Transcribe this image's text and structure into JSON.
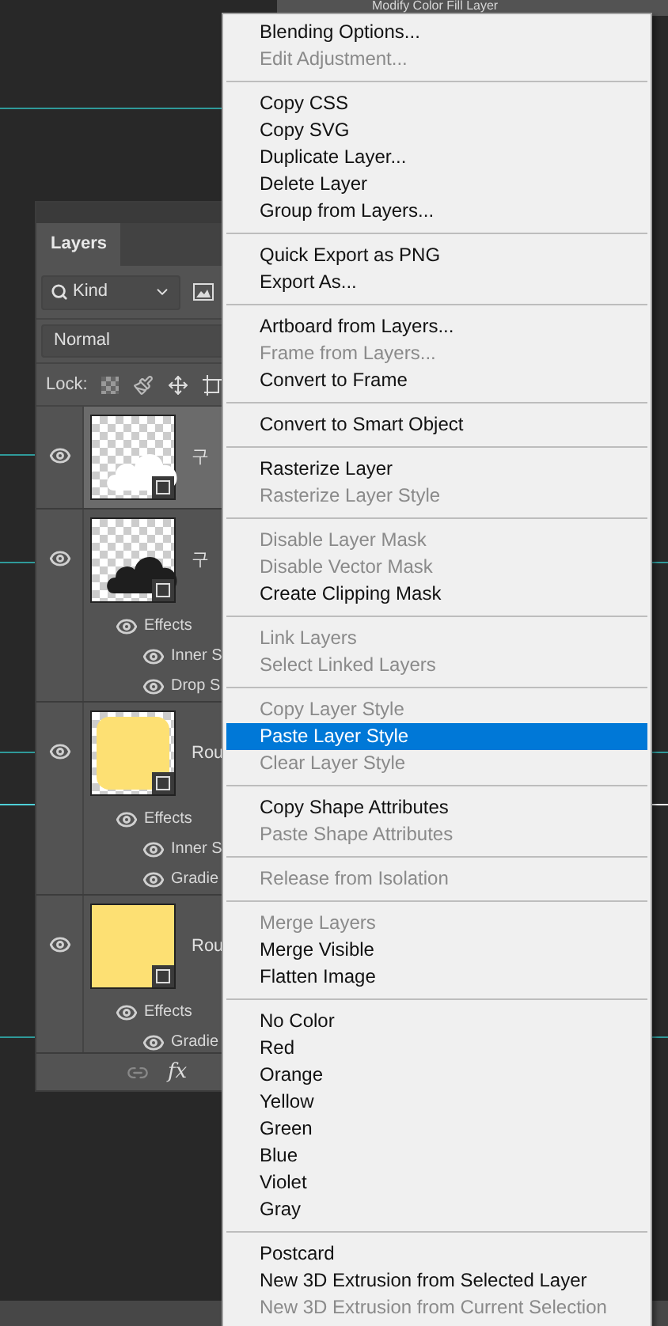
{
  "history": {
    "item": "Modify Color Fill Layer"
  },
  "layers_panel": {
    "tab": "Layers",
    "filter": "Kind",
    "blend_mode": "Normal",
    "lock_label": "Lock:",
    "layers": [
      {
        "name": "구",
        "kind": "cloud_white",
        "selected": true
      },
      {
        "name": "구",
        "kind": "cloud_black",
        "selected": false,
        "effects_label": "Effects",
        "effects": [
          "Inner S",
          "Drop S"
        ]
      },
      {
        "name": "Rou",
        "kind": "rounded_yellow",
        "selected": false,
        "effects_label": "Effects",
        "effects": [
          "Inner S",
          "Gradie"
        ]
      },
      {
        "name": "Rou",
        "kind": "square_yellow",
        "selected": false,
        "effects_label": "Effects",
        "effects": [
          "Gradie"
        ]
      }
    ],
    "fx_label": "fx"
  },
  "context_menu": {
    "groups": [
      [
        {
          "label": "Blending Options...",
          "disabled": false,
          "selected": false
        },
        {
          "label": "Edit Adjustment...",
          "disabled": true,
          "selected": false
        }
      ],
      [
        {
          "label": "Copy CSS",
          "disabled": false,
          "selected": false
        },
        {
          "label": "Copy SVG",
          "disabled": false,
          "selected": false
        },
        {
          "label": "Duplicate Layer...",
          "disabled": false,
          "selected": false
        },
        {
          "label": "Delete Layer",
          "disabled": false,
          "selected": false
        },
        {
          "label": "Group from Layers...",
          "disabled": false,
          "selected": false
        }
      ],
      [
        {
          "label": "Quick Export as PNG",
          "disabled": false,
          "selected": false
        },
        {
          "label": "Export As...",
          "disabled": false,
          "selected": false
        }
      ],
      [
        {
          "label": "Artboard from Layers...",
          "disabled": false,
          "selected": false
        },
        {
          "label": "Frame from Layers...",
          "disabled": true,
          "selected": false
        },
        {
          "label": "Convert to Frame",
          "disabled": false,
          "selected": false
        }
      ],
      [
        {
          "label": "Convert to Smart Object",
          "disabled": false,
          "selected": false
        }
      ],
      [
        {
          "label": "Rasterize Layer",
          "disabled": false,
          "selected": false
        },
        {
          "label": "Rasterize Layer Style",
          "disabled": true,
          "selected": false
        }
      ],
      [
        {
          "label": "Disable Layer Mask",
          "disabled": true,
          "selected": false
        },
        {
          "label": "Disable Vector Mask",
          "disabled": true,
          "selected": false
        },
        {
          "label": "Create Clipping Mask",
          "disabled": false,
          "selected": false
        }
      ],
      [
        {
          "label": "Link Layers",
          "disabled": true,
          "selected": false
        },
        {
          "label": "Select Linked Layers",
          "disabled": true,
          "selected": false
        }
      ],
      [
        {
          "label": "Copy Layer Style",
          "disabled": true,
          "selected": false
        },
        {
          "label": "Paste Layer Style",
          "disabled": false,
          "selected": true
        },
        {
          "label": "Clear Layer Style",
          "disabled": true,
          "selected": false
        }
      ],
      [
        {
          "label": "Copy Shape Attributes",
          "disabled": false,
          "selected": false
        },
        {
          "label": "Paste Shape Attributes",
          "disabled": true,
          "selected": false
        }
      ],
      [
        {
          "label": "Release from Isolation",
          "disabled": true,
          "selected": false
        }
      ],
      [
        {
          "label": "Merge Layers",
          "disabled": true,
          "selected": false
        },
        {
          "label": "Merge Visible",
          "disabled": false,
          "selected": false
        },
        {
          "label": "Flatten Image",
          "disabled": false,
          "selected": false
        }
      ],
      [
        {
          "label": "No Color",
          "disabled": false,
          "selected": false
        },
        {
          "label": "Red",
          "disabled": false,
          "selected": false
        },
        {
          "label": "Orange",
          "disabled": false,
          "selected": false
        },
        {
          "label": "Yellow",
          "disabled": false,
          "selected": false
        },
        {
          "label": "Green",
          "disabled": false,
          "selected": false
        },
        {
          "label": "Blue",
          "disabled": false,
          "selected": false
        },
        {
          "label": "Violet",
          "disabled": false,
          "selected": false
        },
        {
          "label": "Gray",
          "disabled": false,
          "selected": false
        }
      ],
      [
        {
          "label": "Postcard",
          "disabled": false,
          "selected": false
        },
        {
          "label": "New 3D Extrusion from Selected Layer",
          "disabled": false,
          "selected": false
        },
        {
          "label": "New 3D Extrusion from Current Selection",
          "disabled": true,
          "selected": false
        }
      ]
    ]
  }
}
